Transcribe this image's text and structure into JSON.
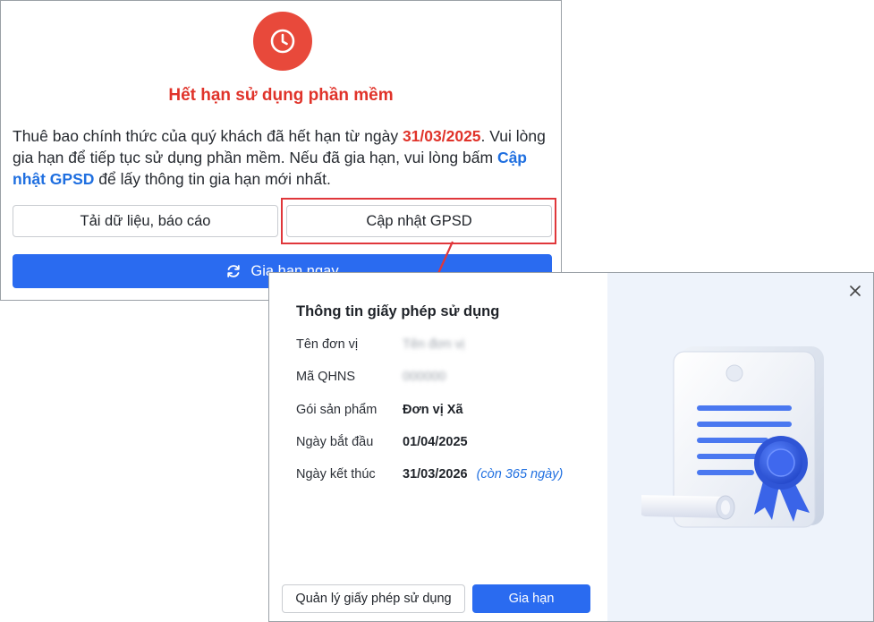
{
  "expired_dialog": {
    "title": "Hết hạn sử dụng phần mềm",
    "message_part1": "Thuê bao chính thức của quý khách đã hết hạn từ ngày ",
    "expiry_date": "31/03/2025",
    "message_part2": ". Vui lòng gia hạn để tiếp tục sử dụng phần mềm. Nếu đã gia hạn, vui lòng bấm ",
    "link_text": "Cập nhật GPSD",
    "message_part3": " để lấy thông tin gia hạn mới nhất.",
    "download_button": "Tải dữ liệu, báo cáo",
    "update_button": "Cập nhật GPSD",
    "renew_button": "Gia hạn ngay",
    "icons": {
      "header": "clock-icon",
      "renew": "refresh-icon"
    },
    "colors": {
      "alert": "#e8493b",
      "title": "#e0332a",
      "link": "#1f6fe0",
      "primary": "#2a6bf0",
      "highlight": "#e0373b"
    }
  },
  "license_dialog": {
    "title": "Thông tin giấy phép sử dụng",
    "rows": [
      {
        "label": "Tên đơn vị",
        "value": "Tên đơn vị"
      },
      {
        "label": "Mã QHNS",
        "value": "000000"
      },
      {
        "label": "Gói sản phẩm",
        "value": "Đơn vị Xã"
      },
      {
        "label": "Ngày bắt đầu",
        "value": "01/04/2025"
      },
      {
        "label": "Ngày kết thúc",
        "value": "31/03/2026",
        "extra": "(còn 365 ngày)"
      }
    ],
    "manage_button": "Quản lý giấy phép sử dụng",
    "extend_button": "Gia hạn",
    "icons": {
      "close": "close-icon",
      "illustration": "certificate-illustration"
    }
  }
}
